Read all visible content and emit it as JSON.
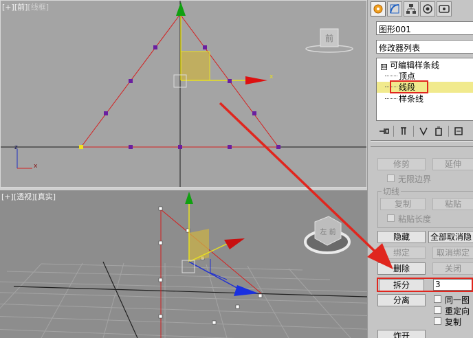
{
  "viewports": {
    "front": {
      "label_open": "[+]",
      "label_name": "[前]",
      "label_mode": "[线框]",
      "viewcube_label": "前",
      "gizmo_x": "x",
      "axis_z": "z",
      "axis_x": "x"
    },
    "perspective": {
      "label_open": "[+]",
      "label_name": "[透视]",
      "label_mode": "[真实]",
      "viewcube_label": "左 前"
    }
  },
  "panel": {
    "tabs": [
      "create-icon",
      "modify-icon",
      "hierarchy-icon",
      "motion-icon",
      "display-icon"
    ],
    "object_name": "图形001",
    "modifier_list": "修改器列表",
    "stack": {
      "root_toggle": "⊟",
      "root": "可编辑样条线",
      "vertex": "顶点",
      "segment": "线段",
      "spline": "样条线"
    },
    "buttons": {
      "trim": "修剪",
      "extend": "延伸",
      "infinite_bounds": "无限边界",
      "tangent_group": "切线",
      "copy": "复制",
      "paste": "粘贴",
      "paste_length": "粘贴长度",
      "hide": "隐藏",
      "unhide_all": "全部取消隐",
      "bind": "绑定",
      "unbind": "取消绑定",
      "delete": "删除",
      "close": "关闭",
      "divide": "拆分",
      "divide_count": "3",
      "detach": "分离",
      "same_shape": "同一图",
      "reorient": "重定向",
      "copy_opt": "复制",
      "explode": "炸开"
    }
  },
  "colors": {
    "accent_red": "#e0261e",
    "spline_red": "#d42020",
    "vertex_purple": "#6a1fa0",
    "selection_yellow": "#f1ea8d",
    "gizmo_green": "#10a010"
  }
}
